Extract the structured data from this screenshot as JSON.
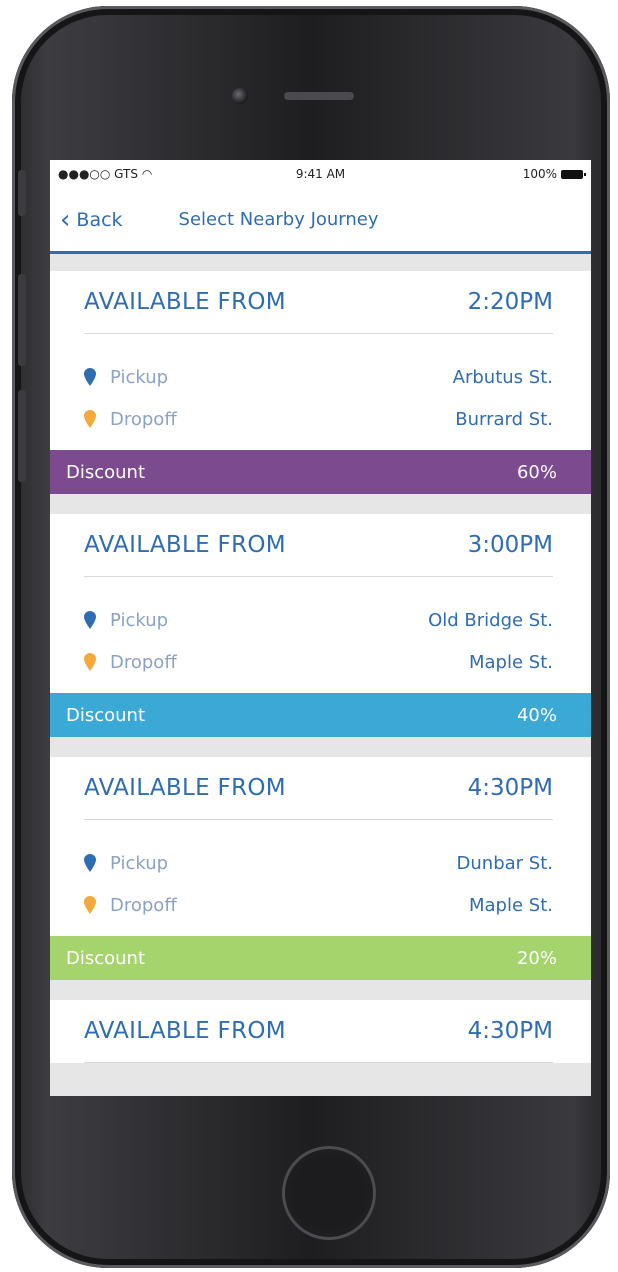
{
  "status_bar": {
    "carrier": "●●●○○ GTS",
    "time": "9:41 AM",
    "battery": "100%"
  },
  "nav": {
    "back_label": "Back",
    "title": "Select Nearby Journey"
  },
  "colors": {
    "primary": "#2f6db2",
    "pickup_pin": "#2f6db2",
    "dropoff_pin": "#f4a93b",
    "discount_60": "#7b4a8f",
    "discount_40": "#3aa9d6",
    "discount_20": "#a4d46b"
  },
  "journeys": [
    {
      "label": "AVAILABLE FROM",
      "time": "2:20PM",
      "pickup_label": "Pickup",
      "pickup_value": "Arbutus St.",
      "dropoff_label": "Dropoff",
      "dropoff_value": "Burrard St.",
      "discount_label": "Discount",
      "discount_value": "60%"
    },
    {
      "label": "AVAILABLE FROM",
      "time": "3:00PM",
      "pickup_label": "Pickup",
      "pickup_value": "Old Bridge St.",
      "dropoff_label": "Dropoff",
      "dropoff_value": "Maple St.",
      "discount_label": "Discount",
      "discount_value": "40%"
    },
    {
      "label": "AVAILABLE FROM",
      "time": "4:30PM",
      "pickup_label": "Pickup",
      "pickup_value": "Dunbar St.",
      "dropoff_label": "Dropoff",
      "dropoff_value": "Maple St.",
      "discount_label": "Discount",
      "discount_value": "20%"
    },
    {
      "label": "AVAILABLE FROM",
      "time": "4:30PM"
    }
  ]
}
